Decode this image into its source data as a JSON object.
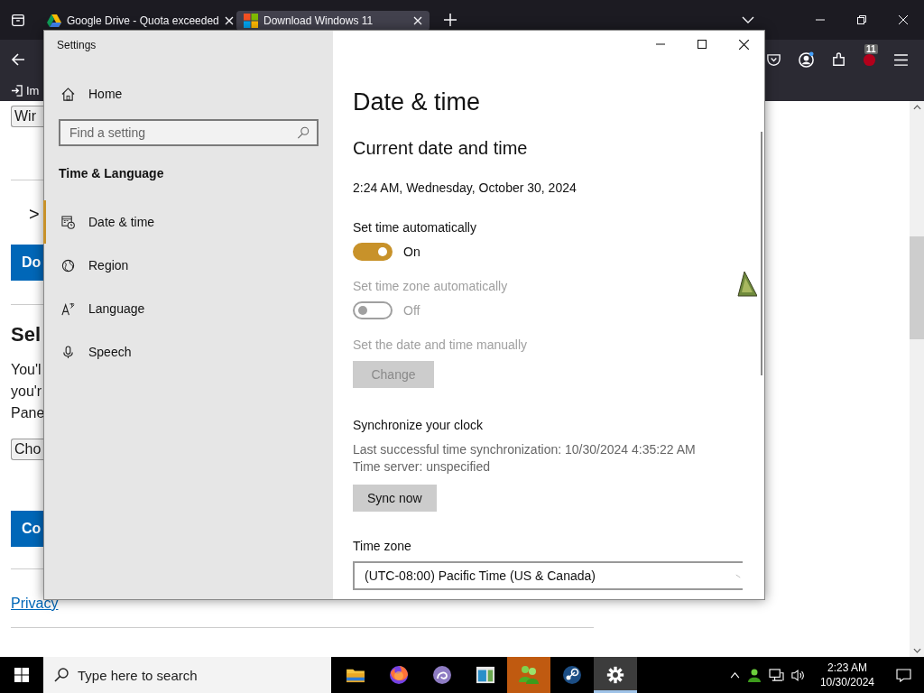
{
  "browser": {
    "tabs": [
      {
        "title": "Google Drive - Quota exceeded",
        "selected": false,
        "kind": "drive"
      },
      {
        "title": "Download Windows 11",
        "selected": true,
        "kind": "windows"
      }
    ],
    "bookmark": "Im",
    "extension_badge": "11"
  },
  "page": {
    "items": [
      {
        "kind": "select",
        "text": "Wir",
        "rule_above": false
      },
      {
        "kind": "chevron",
        "text": ">",
        "rule_above": true
      },
      {
        "kind": "button",
        "text": "Do",
        "rule_above": false
      },
      {
        "kind": "heading",
        "text": "Sel",
        "rule_above": true
      },
      {
        "kind": "paragraph",
        "lines": [
          "You'l",
          "you'r",
          "Pane"
        ],
        "rule_above": false
      },
      {
        "kind": "select",
        "text": "Cho",
        "rule_above": false
      },
      {
        "kind": "button",
        "text": "Co",
        "rule_above": false
      },
      {
        "kind": "link",
        "text": "Privacy",
        "rule_above": true
      }
    ]
  },
  "settings": {
    "title": "Settings",
    "home": "Home",
    "search_placeholder": "Find a setting",
    "section": "Time & Language",
    "nav": [
      {
        "label": "Date & time",
        "kind": "clock",
        "selected": true
      },
      {
        "label": "Region",
        "kind": "globe",
        "selected": false
      },
      {
        "label": "Language",
        "kind": "language",
        "selected": false
      },
      {
        "label": "Speech",
        "kind": "mic",
        "selected": false
      }
    ],
    "heading": "Date & time",
    "subheading": "Current date and time",
    "current": "2:24 AM, Wednesday, October 30, 2024",
    "blocks": [
      {
        "kind": "toggle",
        "label": "Set time automatically",
        "on": true,
        "state_text": "On",
        "disabled": false
      },
      {
        "kind": "toggle",
        "label": "Set time zone automatically",
        "on": false,
        "state_text": "Off",
        "disabled": true
      },
      {
        "kind": "button",
        "label": "Set the date and time manually",
        "button": "Change",
        "disabled": true
      },
      {
        "kind": "sync",
        "label": "Synchronize your clock",
        "lines": [
          "Last successful time synchronization: 10/30/2024 4:35:22 AM",
          "Time server: unspecified"
        ],
        "button": "Sync now",
        "disabled": false
      },
      {
        "kind": "dropdown",
        "label": "Time zone",
        "value": "(UTC-08:00) Pacific Time (US & Canada)"
      }
    ]
  },
  "taskbar": {
    "search_placeholder": "Type here to search",
    "apps": [
      {
        "kind": "folder",
        "selected": false,
        "attention": false
      },
      {
        "kind": "firefox",
        "selected": false,
        "attention": false
      },
      {
        "kind": "torrent",
        "selected": false,
        "attention": false
      },
      {
        "kind": "window",
        "selected": false,
        "attention": false
      },
      {
        "kind": "people",
        "selected": false,
        "attention": true
      },
      {
        "kind": "steam",
        "selected": false,
        "attention": false
      },
      {
        "kind": "gear",
        "selected": true,
        "attention": false
      }
    ],
    "time": "2:23 AM",
    "date": "10/30/2024"
  }
}
